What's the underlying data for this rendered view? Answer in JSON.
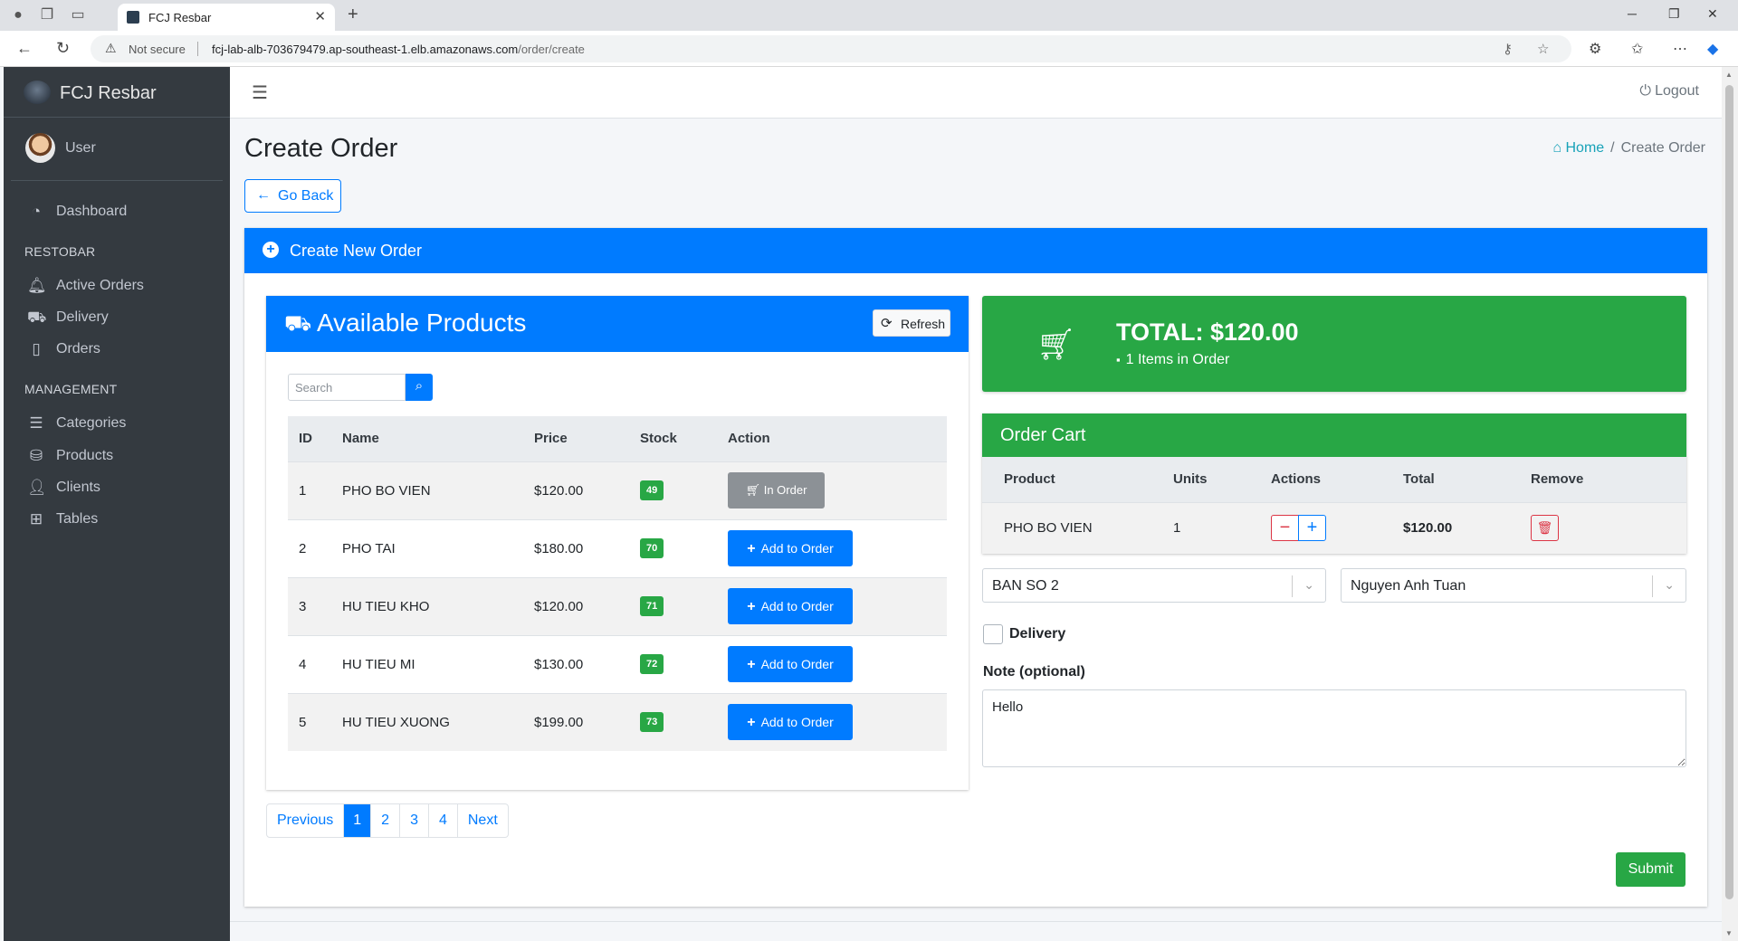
{
  "browser": {
    "tab_title": "FCJ Resbar",
    "not_secure": "Not secure",
    "url_host": "fcj-lab-alb-703679479.ap-southeast-1.elb.amazonaws.com",
    "url_path": "/order/create"
  },
  "sidebar": {
    "brand": "FCJ Resbar",
    "user": "User",
    "dashboard": "Dashboard",
    "section_restobar": "RESTOBAR",
    "active_orders": "Active Orders",
    "delivery": "Delivery",
    "orders": "Orders",
    "section_management": "MANAGEMENT",
    "categories": "Categories",
    "products": "Products",
    "clients": "Clients",
    "tables": "Tables"
  },
  "topbar": {
    "logout": "Logout"
  },
  "page": {
    "title": "Create Order",
    "breadcrumb_home": "Home",
    "breadcrumb_current": "Create Order",
    "go_back": "Go Back",
    "card_title": "Create New Order"
  },
  "products_panel": {
    "title": "Available Products",
    "refresh": "Refresh",
    "search_placeholder": "Search",
    "headers": {
      "id": "ID",
      "name": "Name",
      "price": "Price",
      "stock": "Stock",
      "action": "Action"
    },
    "rows": [
      {
        "id": "1",
        "name": "PHO BO VIEN",
        "price": "$120.00",
        "stock": "49",
        "action": "In Order"
      },
      {
        "id": "2",
        "name": "PHO TAI",
        "price": "$180.00",
        "stock": "70",
        "action": "Add to Order"
      },
      {
        "id": "3",
        "name": "HU TIEU KHO",
        "price": "$120.00",
        "stock": "71",
        "action": "Add to Order"
      },
      {
        "id": "4",
        "name": "HU TIEU MI",
        "price": "$130.00",
        "stock": "72",
        "action": "Add to Order"
      },
      {
        "id": "5",
        "name": "HU TIEU XUONG",
        "price": "$199.00",
        "stock": "73",
        "action": "Add to Order"
      }
    ]
  },
  "pagination": {
    "previous": "Previous",
    "p1": "1",
    "p2": "2",
    "p3": "3",
    "p4": "4",
    "next": "Next",
    "active_page": "1"
  },
  "summary": {
    "total": "TOTAL: $120.00",
    "items": "1 Items in Order"
  },
  "cart": {
    "title": "Order Cart",
    "headers": {
      "product": "Product",
      "units": "Units",
      "actions": "Actions",
      "total": "Total",
      "remove": "Remove"
    },
    "row": {
      "product": "PHO BO VIEN",
      "units": "1",
      "total": "$120.00"
    },
    "minus": "−",
    "plus": "+"
  },
  "form": {
    "table_select": "BAN SO 2",
    "client_select": "Nguyen Anh Tuan",
    "delivery_label": "Delivery",
    "delivery_checked": false,
    "note_label": "Note (optional)",
    "note_value": "Hello",
    "submit": "Submit"
  },
  "colors": {
    "primary": "#007bff",
    "success": "#28a745",
    "danger": "#dc3545",
    "sidebar": "#343a40"
  },
  "icons": {
    "search": "search-icon",
    "cart": "shopping-cart-icon",
    "refresh": "refresh-icon",
    "trash": "trash-icon",
    "home": "home-icon",
    "power": "power-icon"
  }
}
